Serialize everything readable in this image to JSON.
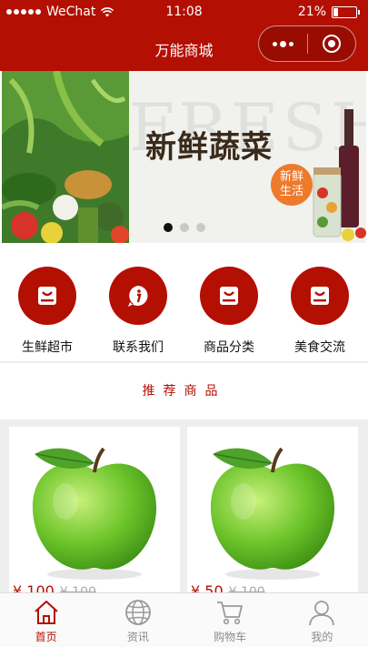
{
  "status_bar": {
    "carrier": "WeChat",
    "time": "11:08",
    "battery_percent": "21%",
    "battery_level": 0.21
  },
  "nav": {
    "title": "万能商城",
    "more_icon": "more-dots-icon",
    "close_icon": "close-target-icon"
  },
  "banner": {
    "background_word": "FRESH",
    "title": "新鲜蔬菜",
    "badge_line1": "新鲜",
    "badge_line2": "生活",
    "slide_count": 3,
    "active_slide": 1
  },
  "quick_nav": [
    {
      "label": "生鲜超市",
      "icon": "shopping-bag-icon"
    },
    {
      "label": "联系我们",
      "icon": "info-chat-icon"
    },
    {
      "label": "商品分类",
      "icon": "shopping-bag-icon"
    },
    {
      "label": "美食交流",
      "icon": "shopping-bag-icon"
    }
  ],
  "recommend": {
    "title": "推荐商品"
  },
  "products": [
    {
      "price": "¥ 100",
      "old_price": "¥ 100",
      "image": "green-apple"
    },
    {
      "price": "¥ 50",
      "old_price": "¥ 100",
      "image": "green-apple"
    }
  ],
  "tabbar": [
    {
      "label": "首页",
      "icon": "home-icon",
      "active": true
    },
    {
      "label": "资讯",
      "icon": "globe-icon",
      "active": false
    },
    {
      "label": "购物车",
      "icon": "cart-icon",
      "active": false
    },
    {
      "label": "我的",
      "icon": "user-icon",
      "active": false
    }
  ],
  "colors": {
    "brand_red": "#b30f02",
    "price_red": "#b30f02",
    "inactive_gray": "#8a8a8a",
    "page_gray": "#eeeeee"
  }
}
